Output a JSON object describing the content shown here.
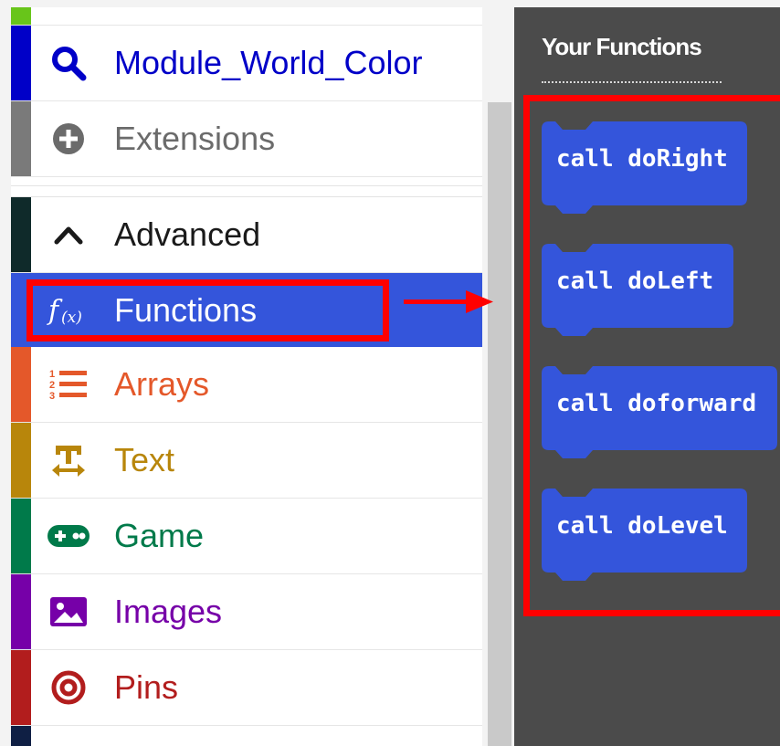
{
  "toolbox": {
    "categories": [
      {
        "id": "module",
        "label": "Module_World_Color",
        "icon": "search-icon",
        "color": "#0000c8",
        "bar_color": "#0000c8"
      },
      {
        "id": "extensions",
        "label": "Extensions",
        "icon": "plus-circle-icon",
        "color": "#6b6b6b",
        "bar_color": "#7a7a7a"
      },
      {
        "id": "advanced",
        "label": "Advanced",
        "icon": "chevron-up-icon",
        "color": "#1a1a1a",
        "bar_color": "#0f2a2a"
      },
      {
        "id": "functions",
        "label": "Functions",
        "icon": "function-icon",
        "color": "#ffffff",
        "bar_color": "#3455db",
        "selected": true
      },
      {
        "id": "arrays",
        "label": "Arrays",
        "icon": "list-icon",
        "color": "#e4582a",
        "bar_color": "#e4582a"
      },
      {
        "id": "text",
        "label": "Text",
        "icon": "text-icon",
        "color": "#b8860b",
        "bar_color": "#b8860b"
      },
      {
        "id": "game",
        "label": "Game",
        "icon": "gamepad-icon",
        "color": "#007a4a",
        "bar_color": "#007a4a"
      },
      {
        "id": "images",
        "label": "Images",
        "icon": "image-icon",
        "color": "#7600a8",
        "bar_color": "#7600a8"
      },
      {
        "id": "pins",
        "label": "Pins",
        "icon": "target-icon",
        "color": "#b21d1d",
        "bar_color": "#b21d1d"
      }
    ]
  },
  "flyout": {
    "title": "Your Functions",
    "block_color": "#3455db",
    "background": "#4b4b4b",
    "blocks": [
      {
        "label": "call doRight"
      },
      {
        "label": "call doLeft"
      },
      {
        "label": "call doforward"
      },
      {
        "label": "call doLevel"
      }
    ]
  },
  "annotations": {
    "highlight_color": "#ff0000"
  }
}
